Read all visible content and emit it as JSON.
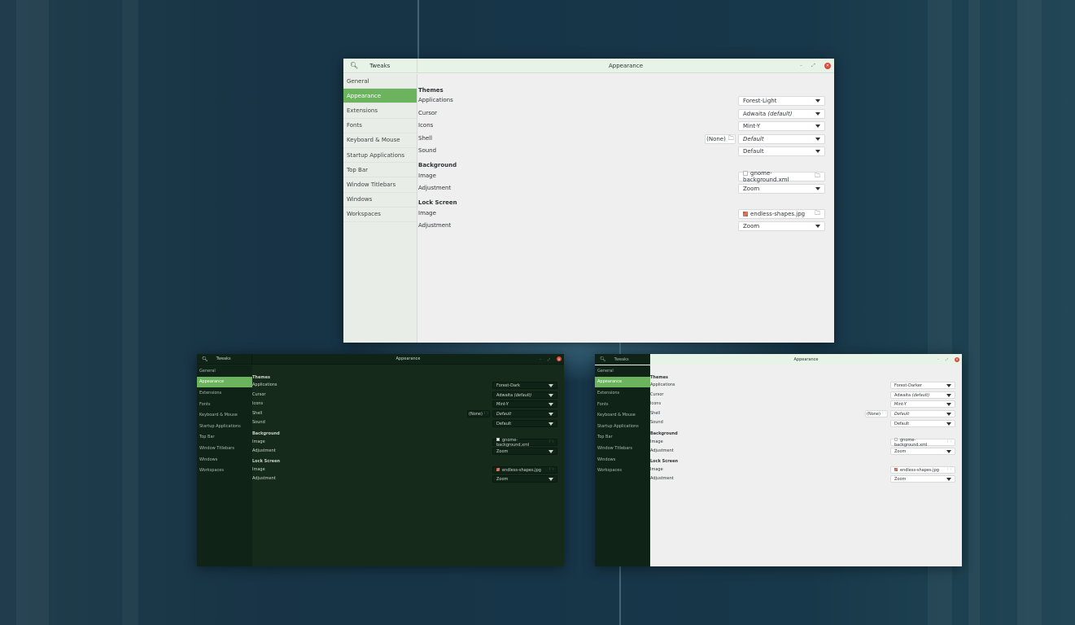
{
  "app_title": "Tweaks",
  "page_title": "Appearance",
  "window_controls": {
    "minimize": "–",
    "maximize": "⤢",
    "close": "✕"
  },
  "sidebar": [
    "General",
    "Appearance",
    "Extensions",
    "Fonts",
    "Keyboard & Mouse",
    "Startup Applications",
    "Top Bar",
    "Window Titlebars",
    "Windows",
    "Workspaces"
  ],
  "sections": {
    "themes": "Themes",
    "background": "Background",
    "lock_screen": "Lock Screen"
  },
  "labels": {
    "applications": "Applications",
    "cursor": "Cursor",
    "icons": "Icons",
    "shell": "Shell",
    "sound": "Sound",
    "image": "Image",
    "adjustment": "Adjustment"
  },
  "values": {
    "cursor_name": "Adwaita",
    "cursor_suffix": "(default)",
    "icons": "Mint-Y",
    "shell_none": "(None)",
    "shell": "Default",
    "sound": "Default",
    "bg_image": "gnome-background.xml",
    "bg_adjustment": "Zoom",
    "lock_image": "endless-shapes.jpg",
    "lock_adjustment": "Zoom"
  },
  "windows": [
    {
      "theme": "light",
      "applications": "Forest-Light"
    },
    {
      "theme": "dark",
      "applications": "Forest-Dark"
    },
    {
      "theme": "mixed",
      "applications": "Forest-Darker"
    }
  ],
  "colors": {
    "accent": "#6bb35c",
    "close": "#e04a3f",
    "desktop": "#173548",
    "dark_bg": "#162a1b",
    "light_bg": "#efefef"
  }
}
